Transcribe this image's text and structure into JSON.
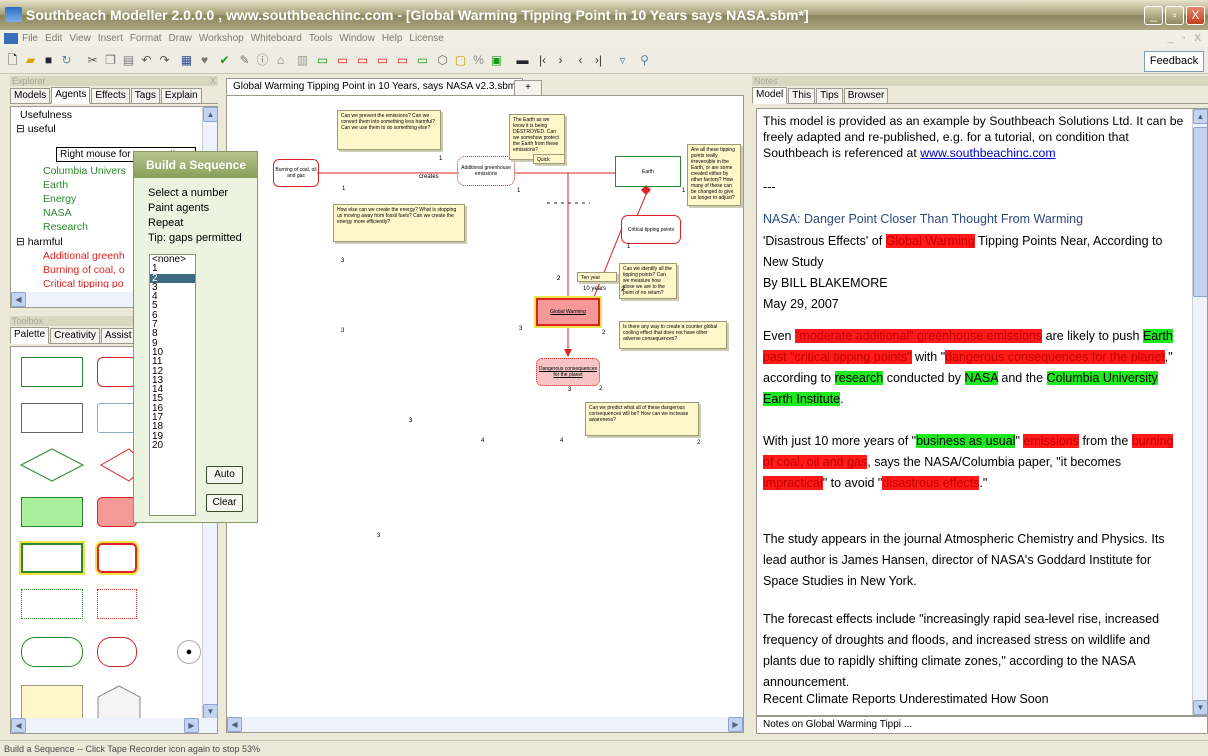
{
  "window": {
    "title": "Southbeach Modeller 2.0.0.0 , www.southbeachinc.com - [Global Warming Tipping Point in 10 Years says NASA.sbm*]",
    "min": "_",
    "max": "▫",
    "close": "X",
    "mdi_controls": "_ ▫ X"
  },
  "menu": [
    "File",
    "Edit",
    "View",
    "Insert",
    "Format",
    "Draw",
    "Workshop",
    "Whiteboard",
    "Tools",
    "Window",
    "Help",
    "License"
  ],
  "toolbar": {
    "feedback": "Feedback"
  },
  "explorer": {
    "header": "Explorer",
    "close": "X",
    "tabs": [
      "Models",
      "Agents",
      "Effects",
      "Tags",
      "Explain"
    ],
    "root": "Usefulness",
    "useful": "useful",
    "useful_items": [
      "Columbia Univers",
      "Earth",
      "Energy",
      "NASA",
      "Research"
    ],
    "harmful": "harmful",
    "harmful_items": [
      "Additional greenh",
      "Burning of coal, o",
      "Critical tipping po"
    ],
    "tooltip": "Right mouse for more options"
  },
  "toolbox": {
    "header": "Toolbox",
    "close": "X",
    "tabs": [
      "Palette",
      "Creativity",
      "Assist"
    ]
  },
  "document": {
    "tab": "Global Warming Tipping Point in 10 Years, says NASA v2.3.sbm",
    "newtab": "+"
  },
  "diagram": {
    "nodes": {
      "burning": "Burning of coal, oil and gas",
      "additional": "Additional greenhouse emissions",
      "earth": "Earth",
      "critical": "Critical tipping points",
      "global": "Global Warming",
      "dangerous": "Dangerous consequences for the planet"
    },
    "label_creates": "creates",
    "notes": {
      "n1": "Can we prevent the emissions? Can we convert them into something less harmful? Can we use them to do something else?",
      "n2": "The Earth as we know it is being DESTROYED. Can we somehow protect the Earth from these emissions?",
      "n2b": "Quick wins?",
      "n3": "Are all these tipping points really irreversible in the Earth, or are some created either by other factors? How many of these can be changed to give us longer to adjust?",
      "n4": "How else can we create the energy? What is stopping us moving away from fossil fuels? Can we create the energy more efficiently?",
      "n5": "Can we identify all the tipping points? Can we measure how close we are to the point of no return?",
      "n5b": "Ten year plan?",
      "n5c": "10 years",
      "n6": "Is there any way to create a counter global cooling effect that does not have other adverse consequences?",
      "n7": "Can we predict what all of these dangerous consequences will be? How can we increase awareness?"
    },
    "counts": [
      "1",
      "1",
      "1",
      "1",
      "1",
      "2",
      "2",
      "2",
      "2",
      "2",
      "3",
      "3",
      "3",
      "3",
      "3",
      "3",
      "4",
      "4",
      "2",
      "2"
    ]
  },
  "sequence": {
    "title": "Build a Sequence",
    "lines": [
      "Select a number",
      "Paint agents",
      "Repeat",
      "Tip: gaps permitted"
    ],
    "items": [
      "<none>",
      "1",
      "2",
      "3",
      "4",
      "5",
      "6",
      "7",
      "8",
      "9",
      "10",
      "11",
      "12",
      "13",
      "14",
      "15",
      "16",
      "17",
      "18",
      "19",
      "20"
    ],
    "selected": "2",
    "auto": "Auto",
    "clear": "Clear"
  },
  "notes_panel": {
    "header": "Notes",
    "tabs": [
      "Model",
      "This",
      "Tips",
      "Browser"
    ],
    "intro": "This model is provided as an example by Southbeach Solutions Ltd. It can be freely adapted and re-published, e.g. for a tutorial, on condition that Southbeach is referenced at ",
    "link": "www.southbeachinc.com",
    "sep": "---",
    "headline": "NASA: Danger Point Closer Than Thought From Warming",
    "sub1": "'Disastrous Effects' of ",
    "sub_hl": "Global Warming",
    "sub2": " Tipping Points Near, According to New Study",
    "byline": "By BILL BLAKEMORE",
    "date": "May 29, 2007",
    "p1": [
      {
        "t": " Even ",
        "c": ""
      },
      {
        "t": "\"moderate additional\" greenhouse emissions",
        "c": "r"
      },
      {
        "t": " are likely to push ",
        "c": ""
      },
      {
        "t": "Earth",
        "c": "g"
      },
      {
        "t": " ",
        "c": ""
      },
      {
        "t": "past \"critical tipping points\"",
        "c": "r"
      },
      {
        "t": " with \"",
        "c": ""
      },
      {
        "t": "dangerous consequences for the planet",
        "c": "r"
      },
      {
        "t": ",\" according to ",
        "c": ""
      },
      {
        "t": "research",
        "c": "g"
      },
      {
        "t": " conducted by ",
        "c": ""
      },
      {
        "t": "NASA",
        "c": "g"
      },
      {
        "t": " and the ",
        "c": ""
      },
      {
        "t": "Columbia University Earth Institute",
        "c": "g"
      },
      {
        "t": ".",
        "c": ""
      }
    ],
    "p2": [
      {
        "t": "With just 10 more years of \"",
        "c": ""
      },
      {
        "t": "business as usual",
        "c": "g"
      },
      {
        "t": "\" ",
        "c": ""
      },
      {
        "t": "emissions",
        "c": "r"
      },
      {
        "t": " from the ",
        "c": ""
      },
      {
        "t": "burning of coal, oil and gas",
        "c": "r"
      },
      {
        "t": ", says the NASA/Columbia paper, \"it becomes ",
        "c": ""
      },
      {
        "t": "impractical",
        "c": "r"
      },
      {
        "t": "\" to avoid \"",
        "c": ""
      },
      {
        "t": "disastrous effects",
        "c": "r"
      },
      {
        "t": ".\"",
        "c": ""
      }
    ],
    "p3": "The study appears in the journal Atmospheric Chemistry and Physics. Its lead author is James Hansen, director of NASA's Goddard Institute for Space Studies in New York.",
    "p4": "The forecast effects include \"increasingly rapid sea-level rise, increased frequency of droughts and floods, and increased stress on wildlife and plants due to rapidly shifting climate zones,\" according to the NASA announcement.",
    "p5": "Recent Climate Reports Underestimated How Soon",
    "footer": "Notes on Global Warming Tippi ..."
  },
  "status": "Build a Sequence -- Click Tape Recorder icon again to stop  53%"
}
